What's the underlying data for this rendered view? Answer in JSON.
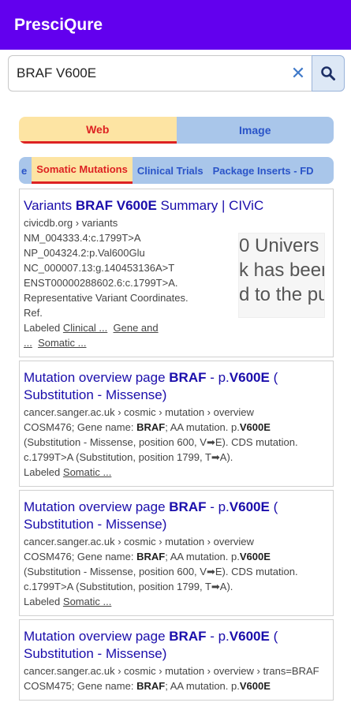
{
  "app": {
    "title": "PresciQure"
  },
  "search": {
    "value": "BRAF V600E",
    "clear_icon": "✕"
  },
  "type_tabs": {
    "web": "Web",
    "image": "Image"
  },
  "category_tabs": {
    "partial_prev": "e",
    "items": [
      "Somatic Mutations",
      "Clinical Trials",
      "Package Inserts - FD"
    ]
  },
  "results": [
    {
      "title_pre": "Variants ",
      "title_bold": "BRAF V600E",
      "title_post": " Summary | CIViC",
      "url": "civicdb.org › variants",
      "lines": [
        "NM_004333.4:c.1799T>A",
        "NP_004324.2:p.Val600Glu",
        "NC_000007.13:g.140453136A>T",
        "ENST00000288602.6:c.1799T>A.",
        "Representative Variant Coordinates.",
        "Ref."
      ],
      "labeled": "Labeled",
      "labels": [
        "Clinical ...",
        "Gene and",
        "...",
        "Somatic ..."
      ],
      "thumb": [
        "0 Univers",
        "k has been",
        "d to the pub"
      ]
    },
    {
      "t1": "Mutation overview page ",
      "t2": "BRAF",
      "t3": " - p.",
      "t4": "V600E",
      "t5": " (",
      "t6": "Substitution - Missense)",
      "url": "cancer.sanger.ac.uk › cosmic › mutation › overview",
      "s1": "COSM476; Gene name: ",
      "s2": "BRAF",
      "s3": "; AA mutation. p.",
      "s4": "V600E",
      "s5": "(Substitution - Missense, position 600, V➡E). CDS mutation. c.1799T>A (Substitution, position 1799, T➡A).",
      "labeled": "Labeled",
      "label": "Somatic ..."
    },
    {
      "t1": "Mutation overview page ",
      "t2": "BRAF",
      "t3": " - p.",
      "t4": "V600E",
      "t5": " (",
      "t6": "Substitution - Missense)",
      "url": "cancer.sanger.ac.uk › cosmic › mutation › overview",
      "s1": "COSM476; Gene name: ",
      "s2": "BRAF",
      "s3": "; AA mutation. p.",
      "s4": "V600E",
      "s5": "(Substitution - Missense, position 600, V➡E). CDS mutation. c.1799T>A (Substitution, position 1799, T➡A).",
      "labeled": "Labeled",
      "label": "Somatic ..."
    },
    {
      "t1": "Mutation overview page ",
      "t2": "BRAF",
      "t3": " - p.",
      "t4": "V600E",
      "t5": " (",
      "t6": "Substitution - Missense)",
      "url": "cancer.sanger.ac.uk › cosmic › mutation › overview › trans=BRAF",
      "s1": "COSM475; Gene name: ",
      "s2": "BRAF",
      "s3": "; AA mutation. p.",
      "s4": "V600E"
    }
  ],
  "colors": {
    "appbar": "#6200ee",
    "active_tab": "#fde4a3",
    "inactive_tab": "#a9c6ea",
    "link": "#1a0dab"
  },
  "icons": {
    "search_button": "search-icon",
    "clear": "close-icon"
  }
}
